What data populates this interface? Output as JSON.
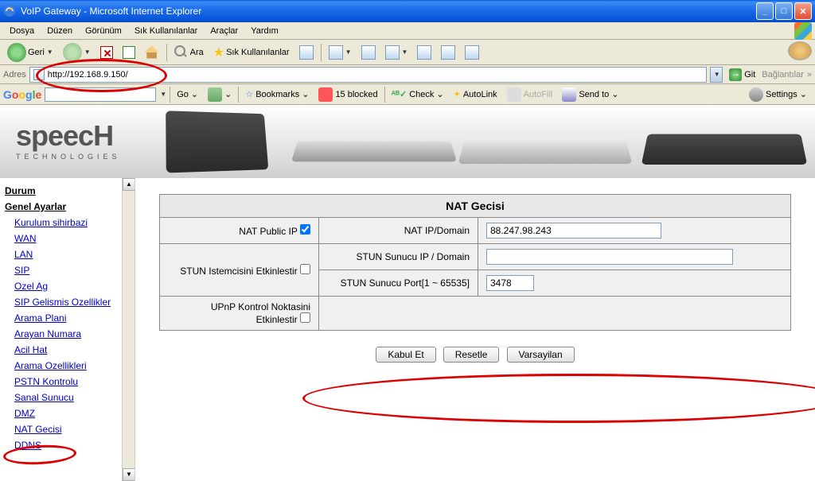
{
  "titlebar": {
    "title": "VoIP Gateway - Microsoft Internet Explorer"
  },
  "menubar": {
    "items": [
      "Dosya",
      "Düzen",
      "Görünüm",
      "Sık Kullanılanlar",
      "Araçlar",
      "Yardım"
    ]
  },
  "toolbar": {
    "back": "Geri",
    "search": "Ara",
    "favorites": "Sık Kullanılanlar"
  },
  "addressbar": {
    "label": "Adres",
    "url": "http://192.168.9.150/",
    "go": "Git",
    "links": "Bağlantılar"
  },
  "gtoolbar": {
    "brand": "Google",
    "go": "Go",
    "bookmarks": "Bookmarks",
    "blocked": "15 blocked",
    "check": "Check",
    "autolink": "AutoLink",
    "autofill": "AutoFill",
    "sendto": "Send to",
    "settings": "Settings"
  },
  "banner": {
    "logo_main": "speecH",
    "logo_sub": "TECHNOLOGIES"
  },
  "sidebar": {
    "durum": "Durum",
    "genel": "Genel Ayarlar",
    "items": [
      "Kurulum sihirbazi",
      "WAN",
      "LAN",
      "SIP",
      "Ozel Ag",
      "SIP Gelismis Ozellikler",
      "Arama Plani",
      "Arayan Numara",
      "Acil Hat",
      "Arama Ozellikleri",
      "PSTN Kontrolu",
      "Sanal Sunucu",
      "DMZ",
      "NAT Gecisi",
      "DDNS"
    ]
  },
  "main": {
    "title": "NAT Gecisi",
    "rows": {
      "nat_public_ip": {
        "label": "NAT Public IP",
        "checked": true
      },
      "nat_ip_domain": {
        "label": "NAT IP/Domain",
        "value": "88.247.98.243"
      },
      "stun_client": {
        "label": "STUN Istemcisini Etkinlestir",
        "checked": false
      },
      "stun_server_ip": {
        "label": "STUN Sunucu IP / Domain",
        "value": ""
      },
      "stun_server_port": {
        "label": "STUN Sunucu Port[1 ~ 65535]",
        "value": "3478"
      },
      "upnp": {
        "label": "UPnP Kontrol Noktasini Etkinlestir",
        "checked": false
      }
    },
    "buttons": {
      "accept": "Kabul Et",
      "reset": "Resetle",
      "default": "Varsayilan"
    }
  }
}
